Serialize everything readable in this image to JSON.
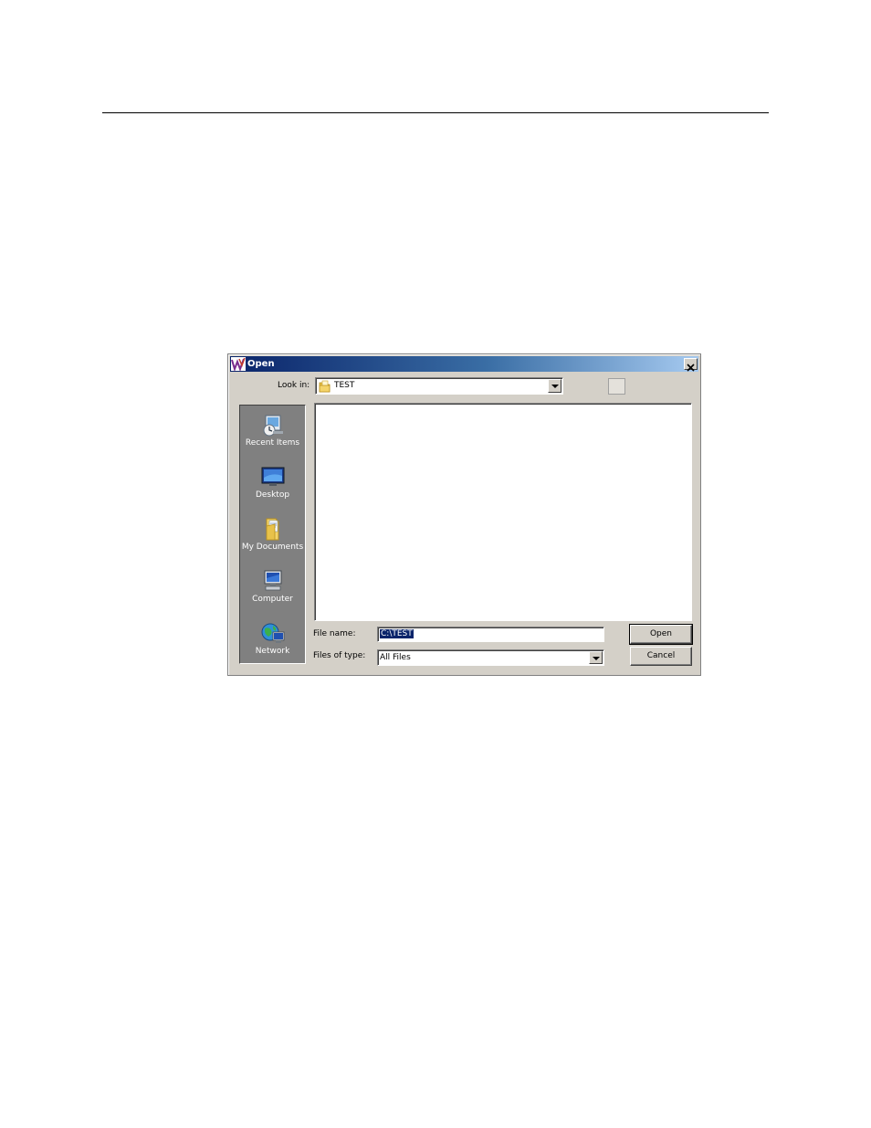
{
  "dialog": {
    "title": "Open",
    "close_glyph": "×",
    "look_in": {
      "label": "Look in:",
      "value": "TEST"
    },
    "places": [
      {
        "label": "Recent Items",
        "icon": "recent-items-icon"
      },
      {
        "label": "Desktop",
        "icon": "desktop-icon"
      },
      {
        "label": "My Documents",
        "icon": "my-documents-icon"
      },
      {
        "label": "Computer",
        "icon": "computer-icon"
      },
      {
        "label": "Network",
        "icon": "network-icon"
      }
    ],
    "file_name": {
      "label": "File name:",
      "value": "C:\\TEST"
    },
    "files_of_type": {
      "label": "Files of type:",
      "value": "All Files"
    },
    "buttons": {
      "open": "Open",
      "cancel": "Cancel"
    }
  },
  "colors": {
    "titlebar_start": "#0a246a",
    "titlebar_end": "#a6caf0",
    "dialog_face": "#d4d0c8",
    "places_bar": "#808080",
    "selection": "#0a246a"
  }
}
